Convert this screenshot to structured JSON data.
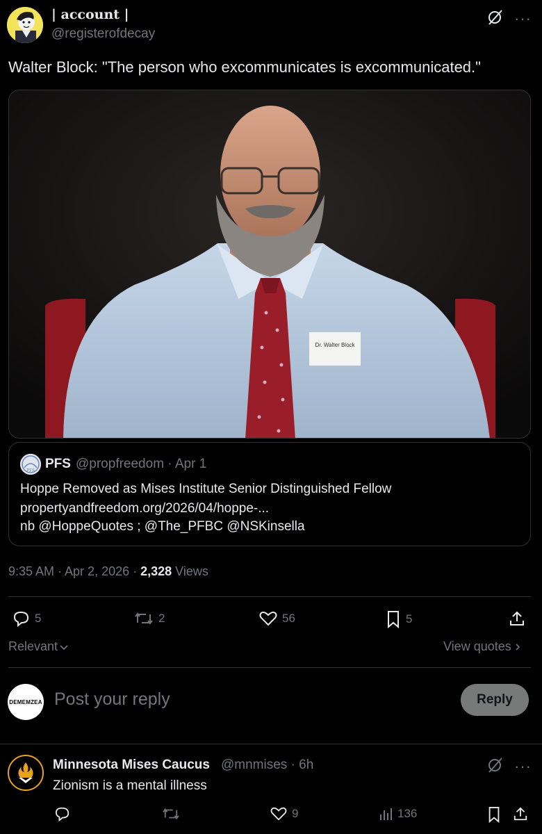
{
  "post": {
    "author_name": "| account |",
    "author_handle": "@registerofdecay",
    "text": "Walter Block: \"The person who excommunicates is excommunicated.\"",
    "photo_badge_text": "Dr. Walter Block",
    "time": "9:35 AM · Apr 2, 2026 · ",
    "views_count": "2,328",
    "views_label": " Views"
  },
  "quoted": {
    "avatar_text": "PFS",
    "name": "PFS",
    "handle": "@propfreedom · Apr 1",
    "line1": "Hoppe Removed as Mises Institute Senior Distinguished Fellow",
    "line2": "propertyandfreedom.org/2026/04/hoppe-...",
    "line3": "nb @HoppeQuotes ; @The_PFBC @NSKinsella"
  },
  "actions": {
    "replies": "5",
    "reposts": "2",
    "likes": "56",
    "bookmarks": "5"
  },
  "sort": {
    "relevant_label": "Relevant",
    "view_quotes_label": "View quotes"
  },
  "compose": {
    "avatar_text": "DEMEMZEA",
    "placeholder": "Post your reply",
    "reply_label": "Reply"
  },
  "reply": {
    "name": "Minnesota Mises Caucus",
    "handle": "@mnmises · 6h",
    "text": "Zionism is a mental illness",
    "likes": "9",
    "views": "136"
  },
  "colors": {
    "background": "#000000",
    "text": "#e7e9ea",
    "muted": "#71767b",
    "divider": "#2f3336",
    "reply_button": "#787a7a"
  }
}
